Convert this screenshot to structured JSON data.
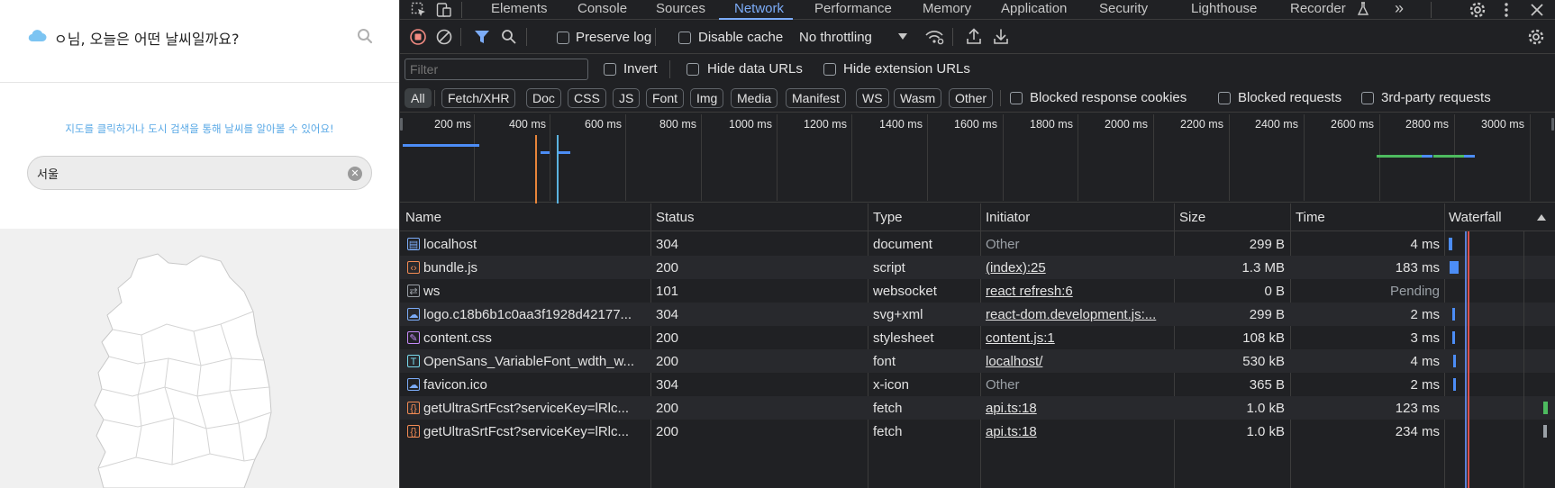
{
  "app": {
    "title": "ㅇ님, 오늘은 어떤 날씨일까요?",
    "hint": "지도를 클릭하거나 도시 검색을 통해 날씨를 알아볼 수 있어요!",
    "city_value": "서울",
    "clear_glyph": "✕"
  },
  "devtools": {
    "tabs": [
      "Elements",
      "Console",
      "Sources",
      "Network",
      "Performance",
      "Memory",
      "Application",
      "Security",
      "Lighthouse",
      "Recorder"
    ],
    "more_glyph": "»",
    "toolbar": {
      "preserve_log": "Preserve log",
      "disable_cache": "Disable cache",
      "throttling": "No throttling"
    },
    "filter": {
      "placeholder": "Filter",
      "invert": "Invert",
      "hide_data_urls": "Hide data URLs",
      "hide_extension_urls": "Hide extension URLs"
    },
    "types": [
      "All",
      "Fetch/XHR",
      "Doc",
      "CSS",
      "JS",
      "Font",
      "Img",
      "Media",
      "Manifest",
      "WS",
      "Wasm",
      "Other"
    ],
    "blocked": {
      "blocked_response_cookies": "Blocked response cookies",
      "blocked_requests": "Blocked requests",
      "third_party": "3rd-party requests"
    },
    "overview_ticks": [
      "200 ms",
      "400 ms",
      "600 ms",
      "800 ms",
      "1000 ms",
      "1200 ms",
      "1400 ms",
      "1600 ms",
      "1800 ms",
      "2000 ms",
      "2200 ms",
      "2400 ms",
      "2600 ms",
      "2800 ms",
      "3000 ms"
    ],
    "columns": {
      "name": "Name",
      "status": "Status",
      "type": "Type",
      "initiator": "Initiator",
      "size": "Size",
      "time": "Time",
      "waterfall": "Waterfall"
    },
    "requests": [
      {
        "name": "localhost",
        "status": "304",
        "type": "document",
        "initiator": "Other",
        "size": "299 B",
        "time": "4 ms",
        "icon": "document-icon",
        "icon_color": "#7cacf8"
      },
      {
        "name": "bundle.js",
        "status": "200",
        "type": "script",
        "initiator": "(index):25",
        "size": "1.3 MB",
        "time": "183 ms",
        "icon": "script-icon",
        "icon_color": "#f28b54"
      },
      {
        "name": "ws",
        "status": "101",
        "type": "websocket",
        "initiator": "react refresh:6",
        "size": "0 B",
        "time": "Pending",
        "icon": "websocket-icon",
        "icon_color": "#9aa0a6"
      },
      {
        "name": "logo.c18b6b1c0aa3f1928d42177...",
        "status": "304",
        "type": "svg+xml",
        "initiator": "react-dom.development.js:...",
        "size": "299 B",
        "time": "2 ms",
        "icon": "image-icon",
        "icon_color": "#7cacf8"
      },
      {
        "name": "content.css",
        "status": "200",
        "type": "stylesheet",
        "initiator": "content.js:1",
        "size": "108 kB",
        "time": "3 ms",
        "icon": "stylesheet-icon",
        "icon_color": "#c58af9"
      },
      {
        "name": "OpenSans_VariableFont_wdth_w...",
        "status": "200",
        "type": "font",
        "initiator": "localhost/",
        "size": "530 kB",
        "time": "4 ms",
        "icon": "font-icon",
        "icon_color": "#78d9ec"
      },
      {
        "name": "favicon.ico",
        "status": "304",
        "type": "x-icon",
        "initiator": "Other",
        "size": "365 B",
        "time": "2 ms",
        "icon": "image-icon",
        "icon_color": "#7cacf8"
      },
      {
        "name": "getUltraSrtFcst?serviceKey=lRlc...",
        "status": "200",
        "type": "fetch",
        "initiator": "api.ts:18",
        "size": "1.0 kB",
        "time": "123 ms",
        "icon": "fetch-icon",
        "icon_color": "#f28b54"
      },
      {
        "name": "getUltraSrtFcst?serviceKey=lRlc...",
        "status": "200",
        "type": "fetch",
        "initiator": "api.ts:18",
        "size": "1.0 kB",
        "time": "234 ms",
        "icon": "fetch-icon",
        "icon_color": "#f28b54"
      }
    ]
  }
}
